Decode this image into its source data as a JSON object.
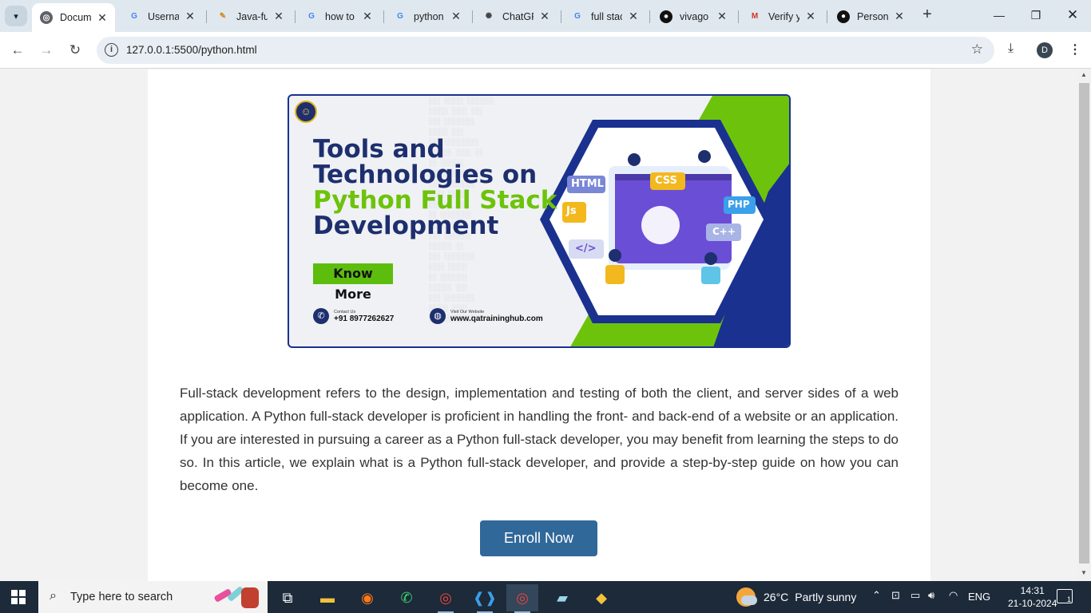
{
  "browser": {
    "tabs": [
      {
        "title": "Document",
        "icon": "globe-icon",
        "active": true
      },
      {
        "title": "Username",
        "icon": "google-icon",
        "active": false
      },
      {
        "title": "Java-full",
        "icon": "pencil-icon",
        "active": false
      },
      {
        "title": "how to",
        "icon": "google-icon",
        "active": false
      },
      {
        "title": "python",
        "icon": "google-icon",
        "active": false
      },
      {
        "title": "ChatGPT",
        "icon": "chatgpt-icon",
        "active": false
      },
      {
        "title": "full stack",
        "icon": "google-icon",
        "active": false
      },
      {
        "title": "vivago",
        "icon": "vivago-icon",
        "active": false
      },
      {
        "title": "Verify y",
        "icon": "gmail-icon",
        "active": false
      },
      {
        "title": "Personal",
        "icon": "github-icon",
        "active": false
      }
    ],
    "url": "127.0.0.1:5500/python.html",
    "profile_initial": "D"
  },
  "banner": {
    "headline_line1": "Tools and",
    "headline_line2": "Technologies on",
    "headline_line3": "Python Full Stack",
    "headline_line4": "Development",
    "button_label": "Know More",
    "contact_label": "Contact Us",
    "contact_value": "+91 8977262627",
    "website_label": "Visit Our Website",
    "website_value": "www.qatraininghub.com",
    "tech_badges": [
      "HTML",
      "CSS",
      "Js",
      "PHP",
      "C++",
      "</>"
    ]
  },
  "content": {
    "paragraph": "Full-stack development refers to the design, implementation and testing of both the client, and server sides of a web application. A Python full-stack developer is proficient in handling the front- and back-end of a website or an application. If you are interested in pursuing a career as a Python full-stack developer, you may benefit from learning the steps to do so. In this article, we explain what is a Python full-stack developer, and provide a step-by-step guide on how you can become one.",
    "enroll_label": "Enroll Now"
  },
  "taskbar": {
    "search_placeholder": "Type here to search",
    "weather_temp": "26°C",
    "weather_desc": "Partly sunny",
    "language": "ENG",
    "time": "14:31",
    "date": "21-10-2024",
    "notification_count": "1"
  },
  "colors": {
    "accent_blue": "#31689a",
    "banner_navy": "#1d2f6e",
    "banner_green": "#6dc30b"
  }
}
